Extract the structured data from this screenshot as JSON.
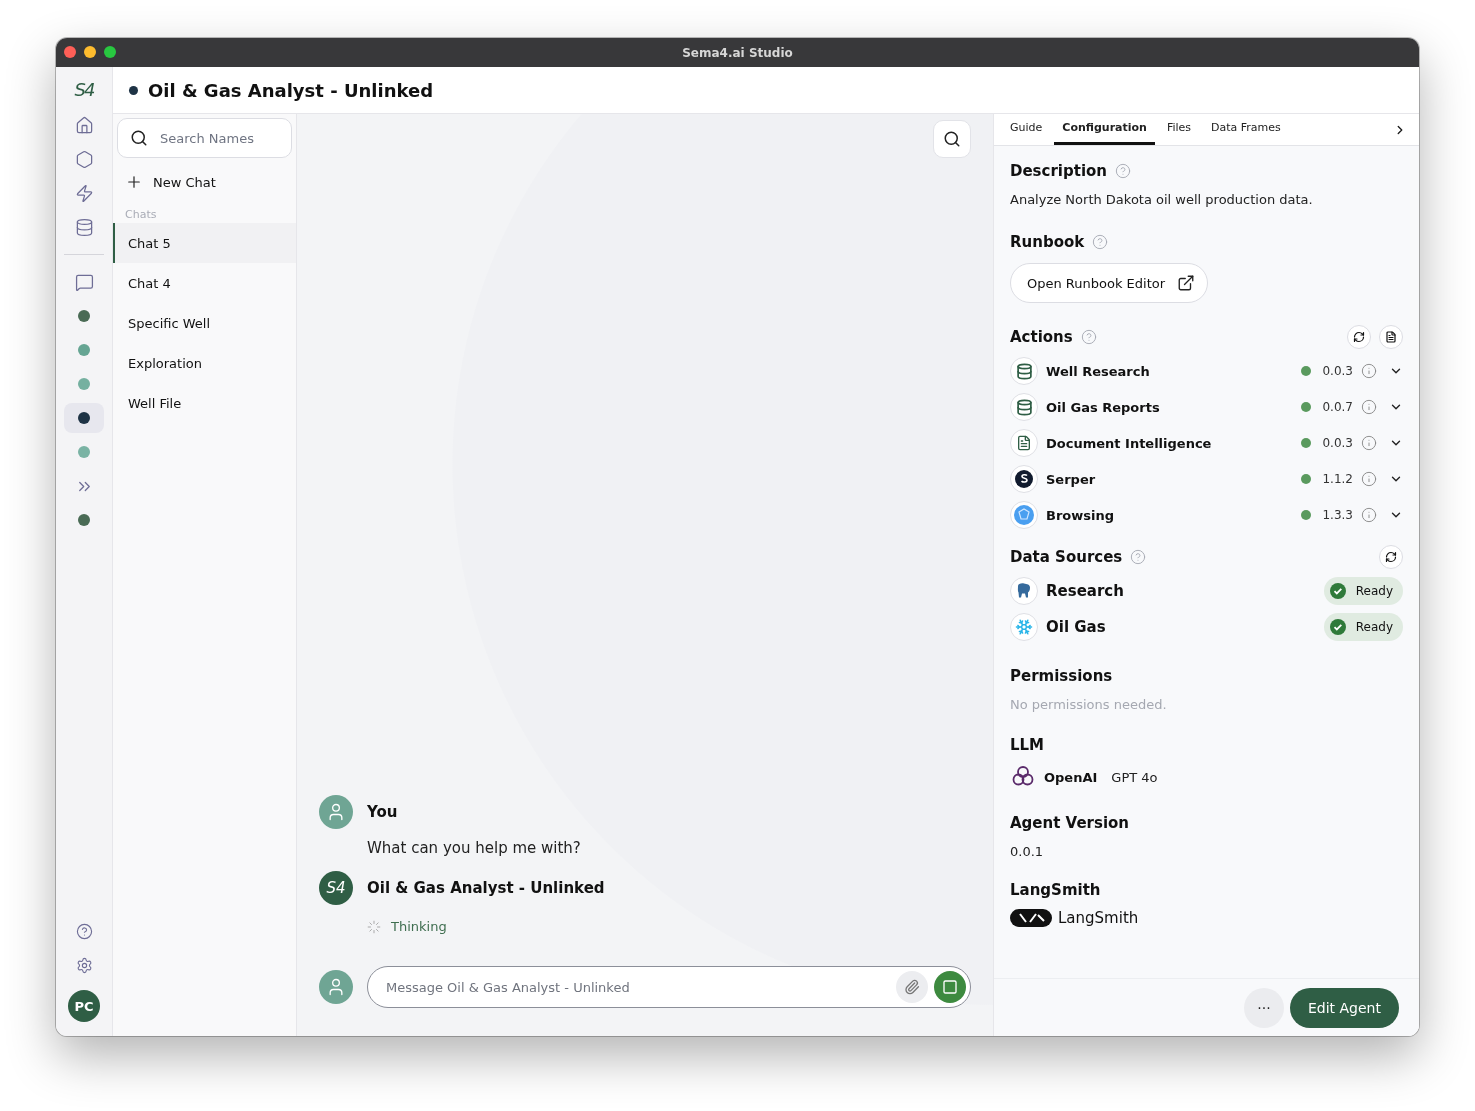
{
  "window": {
    "title": "Sema4.ai Studio"
  },
  "rail": {
    "logo": "S4",
    "items": [
      {
        "kind": "home",
        "selected": false
      },
      {
        "kind": "agents",
        "selected": false
      },
      {
        "kind": "actions",
        "selected": false
      },
      {
        "kind": "data",
        "selected": false
      }
    ],
    "agents": [
      {
        "kind": "chat",
        "selected": false
      },
      {
        "kind": "agent",
        "color": "#4a6b55",
        "selected": false
      },
      {
        "kind": "agent",
        "color": "#66a593",
        "selected": false
      },
      {
        "kind": "agent",
        "color": "#75b0a0",
        "selected": false
      },
      {
        "kind": "agent",
        "color": "#1e3345",
        "selected": true
      },
      {
        "kind": "agent",
        "color": "#7ab3a4",
        "selected": false
      },
      {
        "kind": "workflow",
        "selected": false
      },
      {
        "kind": "agent",
        "color": "#4a6b55",
        "selected": false
      }
    ],
    "bottom": [
      {
        "kind": "help"
      },
      {
        "kind": "settings"
      }
    ],
    "avatar": "PC"
  },
  "header": {
    "title": "Oil & Gas Analyst - Unlinked"
  },
  "chat_list": {
    "search": {
      "placeholder": "Search Names"
    },
    "new_chat": "New Chat",
    "section": "Chats",
    "items": [
      {
        "label": "Chat 5",
        "selected": true
      },
      {
        "label": "Chat 4",
        "selected": false
      },
      {
        "label": "Specific Well",
        "selected": false
      },
      {
        "label": "Exploration",
        "selected": false
      },
      {
        "label": "Well File",
        "selected": false
      }
    ]
  },
  "conversation": {
    "messages": [
      {
        "kind": "user",
        "author": "You",
        "text": "What can you help me with?"
      },
      {
        "kind": "agent",
        "author": "Oil & Gas Analyst - Unlinked",
        "avatar": "S4",
        "status": "Thinking"
      }
    ],
    "composer": {
      "placeholder": "Message Oil & Gas Analyst - Unlinked"
    }
  },
  "panel": {
    "tabs": [
      {
        "label": "Guide",
        "selected": false
      },
      {
        "label": "Configuration",
        "selected": true
      },
      {
        "label": "Files",
        "selected": false
      },
      {
        "label": "Data Frames",
        "selected": false
      }
    ],
    "description": {
      "title": "Description",
      "text": "Analyze North Dakota oil well production data."
    },
    "runbook": {
      "title": "Runbook",
      "button": "Open Runbook Editor"
    },
    "actions": {
      "title": "Actions",
      "items": [
        {
          "name": "Well Research",
          "version": "0.0.3",
          "kind": "database",
          "color": "#5a9a5e"
        },
        {
          "name": "Oil Gas Reports",
          "version": "0.0.7",
          "kind": "database",
          "color": "#5a9a5e"
        },
        {
          "name": "Document Intelligence",
          "version": "0.0.3",
          "kind": "document",
          "color": "#5a9a5e"
        },
        {
          "name": "Serper",
          "version": "1.1.2",
          "kind": "serper",
          "color": "#5a9a5e"
        },
        {
          "name": "Browsing",
          "version": "1.3.3",
          "kind": "browsing",
          "color": "#5a9a5e"
        }
      ]
    },
    "data_sources": {
      "title": "Data Sources",
      "items": [
        {
          "name": "Research",
          "kind": "postgres",
          "status": "Ready"
        },
        {
          "name": "Oil Gas",
          "kind": "snowflake",
          "status": "Ready"
        }
      ]
    },
    "permissions": {
      "title": "Permissions",
      "text": "No permissions needed."
    },
    "llm": {
      "title": "LLM",
      "provider": "OpenAI",
      "model": "GPT 4o"
    },
    "agent_version": {
      "title": "Agent Version",
      "value": "0.0.1"
    },
    "langsmith": {
      "title": "LangSmith",
      "label": "LangSmith"
    },
    "footer": {
      "more": "···",
      "edit": "Edit Agent"
    }
  }
}
